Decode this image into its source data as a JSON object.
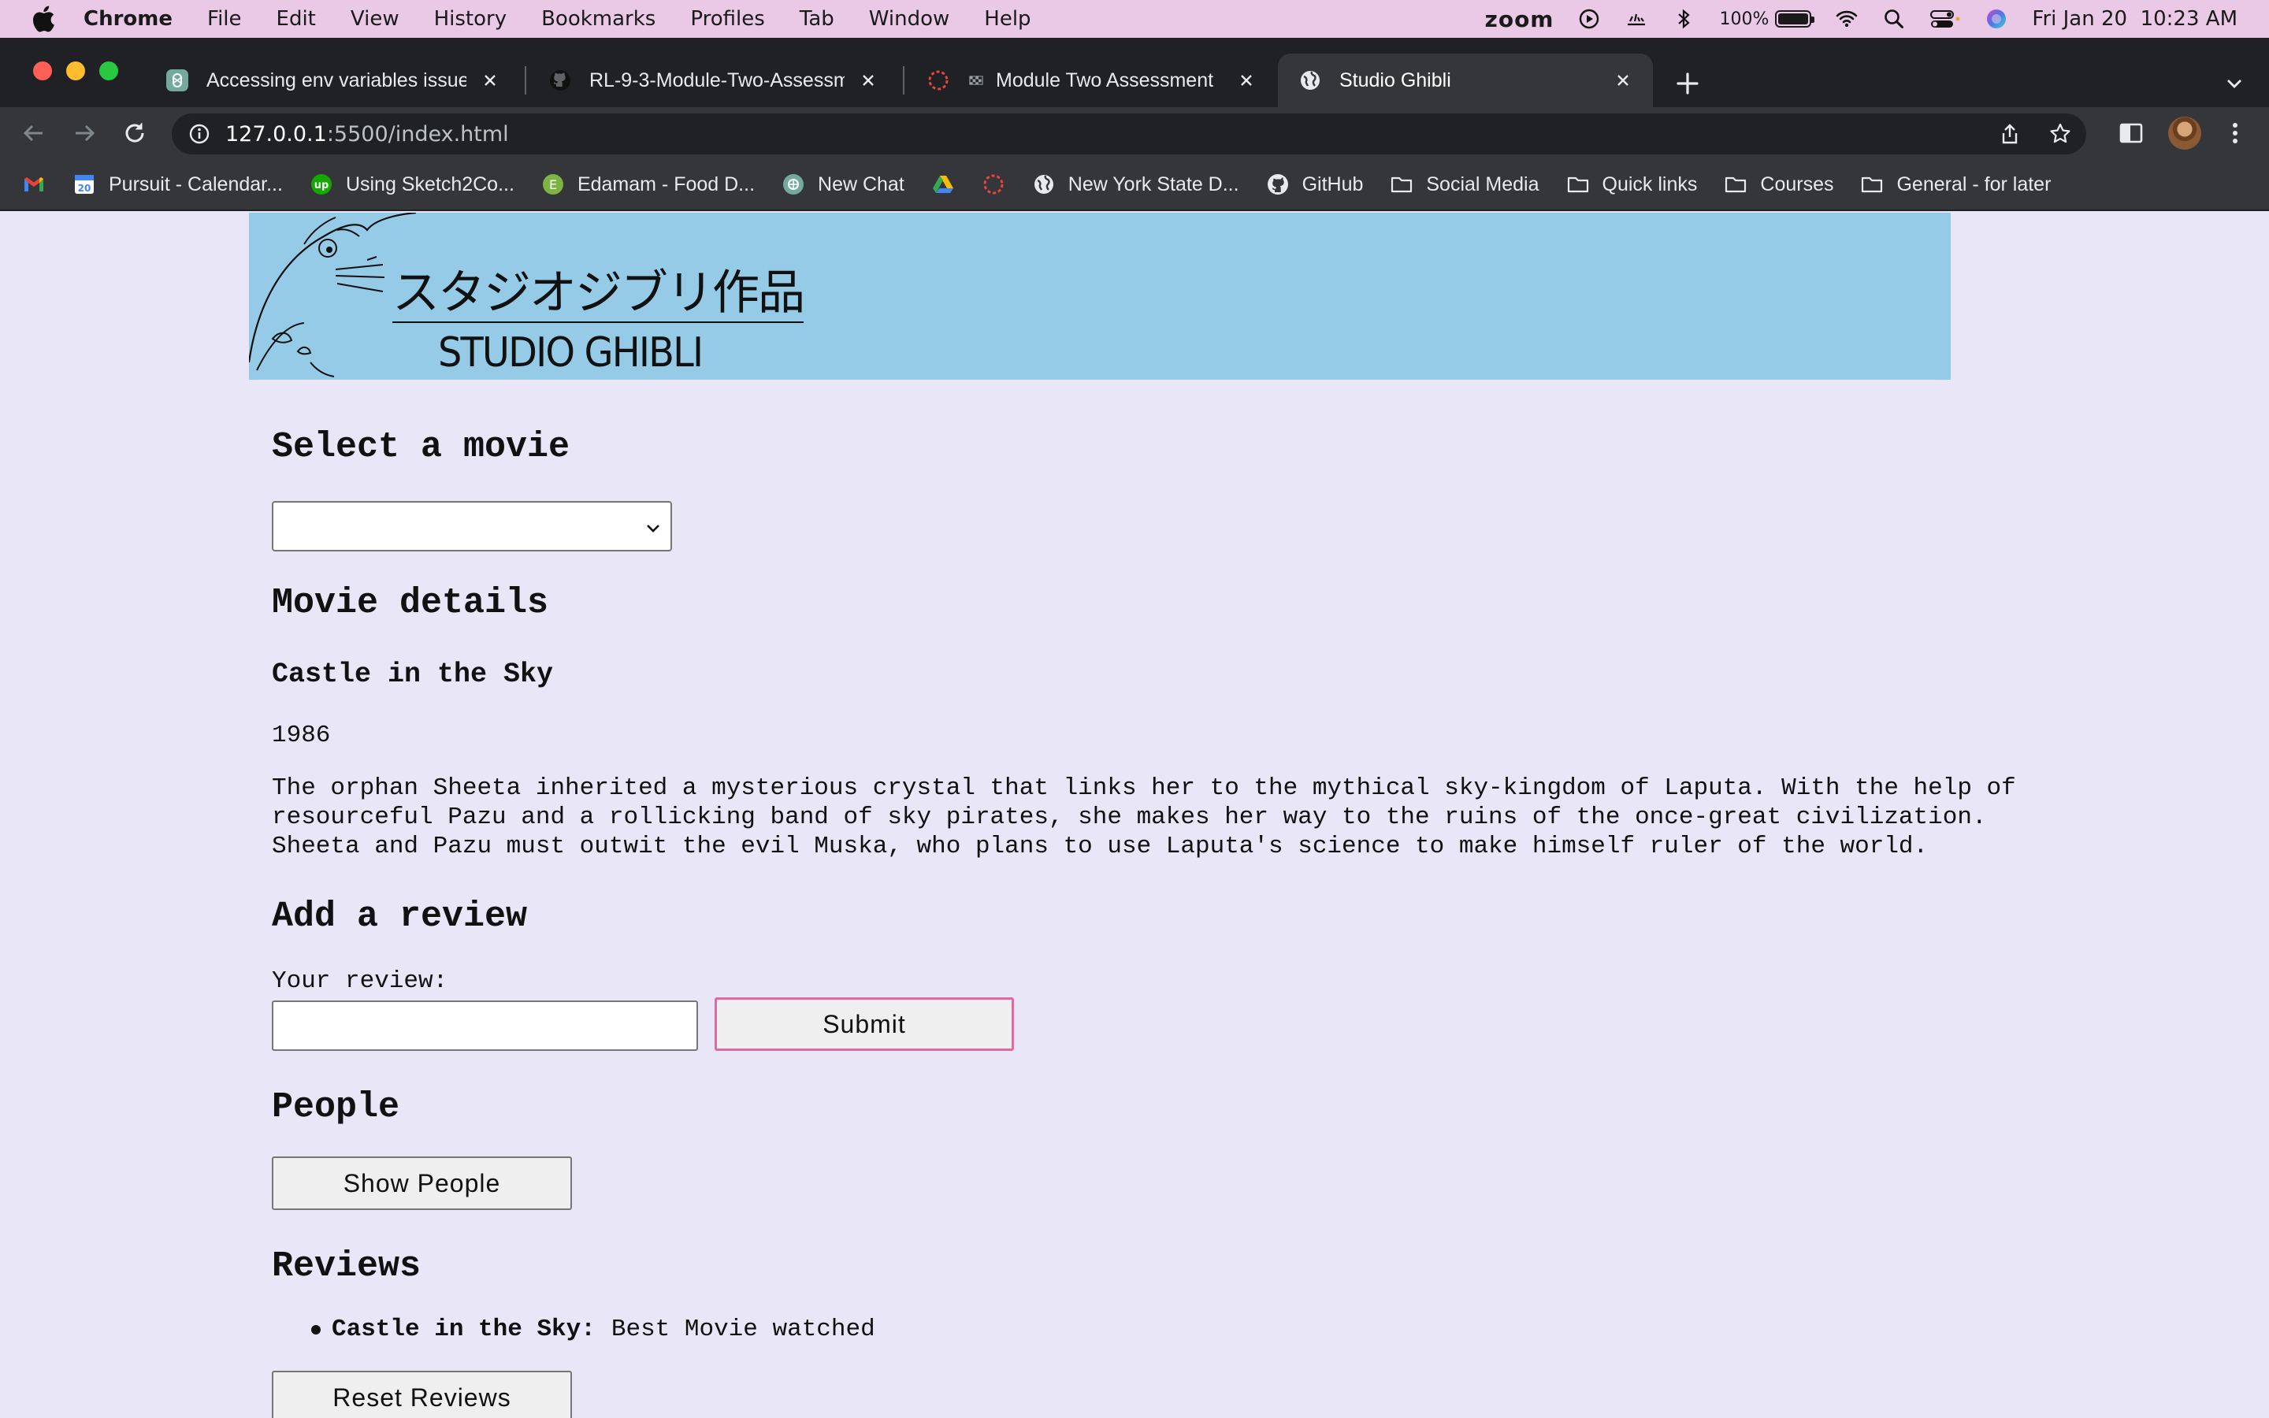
{
  "menubar": {
    "app": "Chrome",
    "items": [
      "File",
      "Edit",
      "View",
      "History",
      "Bookmarks",
      "Profiles",
      "Tab",
      "Window",
      "Help"
    ],
    "zoom_label": "zoom",
    "battery": "100%",
    "datetime": "Fri Jan 20  10:23 AM"
  },
  "tabs": [
    {
      "title": "Accessing env variables issue",
      "icon": "openai-icon"
    },
    {
      "title": "RL-9-3-Module-Two-Assessm",
      "icon": "github-icon"
    },
    {
      "title": "Module Two Assessment",
      "icon": "pursuit-icon"
    },
    {
      "title": "Studio Ghibli",
      "icon": "globe-icon",
      "active": true
    }
  ],
  "address": {
    "host": "127.0.0.1",
    "rest": ":5500/index.html"
  },
  "bookmarks": [
    {
      "label": "",
      "icon": "gmail-icon"
    },
    {
      "label": "Pursuit - Calendar...",
      "icon": "calendar-icon"
    },
    {
      "label": "Using Sketch2Co...",
      "icon": "upwork-icon"
    },
    {
      "label": "Edamam - Food D...",
      "icon": "edamam-icon"
    },
    {
      "label": "New Chat",
      "icon": "openai-icon"
    },
    {
      "label": "",
      "icon": "drive-icon"
    },
    {
      "label": "",
      "icon": "pursuit-icon"
    },
    {
      "label": "New York State D...",
      "icon": "globe-icon"
    },
    {
      "label": "GitHub",
      "icon": "github-icon"
    },
    {
      "label": "Social Media",
      "icon": "folder-icon"
    },
    {
      "label": "Quick links",
      "icon": "folder-icon"
    },
    {
      "label": "Courses",
      "icon": "folder-icon"
    },
    {
      "label": "General - for later",
      "icon": "folder-icon"
    }
  ],
  "page": {
    "banner": {
      "jp": "スタジオジブリ作品",
      "en": "STUDIO GHIBLI"
    },
    "select_heading": "Select a movie",
    "select_value": "",
    "details_heading": "Movie details",
    "movie": {
      "title": "Castle in the Sky",
      "year": "1986",
      "description": "The orphan Sheeta inherited a mysterious crystal that links her to the mythical sky-kingdom of Laputa. With the help of\nresourceful Pazu and a rollicking band of sky pirates, she makes her way to the ruins of the once-great civilization.\nSheeta and Pazu must outwit the evil Muska, who plans to use Laputa's science to make himself ruler of the world."
    },
    "review_heading": "Add a review",
    "review_label": "Your review:",
    "review_value": "",
    "submit_label": "Submit",
    "people_heading": "People",
    "show_people_label": "Show People",
    "reviews_heading": "Reviews",
    "reviews": [
      {
        "movie": "Castle in the Sky:",
        "text": "Best Movie watched"
      }
    ],
    "reset_label": "Reset Reviews"
  },
  "colors": {
    "page_bg": "#e9e6f8",
    "banner_bg": "#96cbe7",
    "submit_border": "#e06aa0"
  }
}
